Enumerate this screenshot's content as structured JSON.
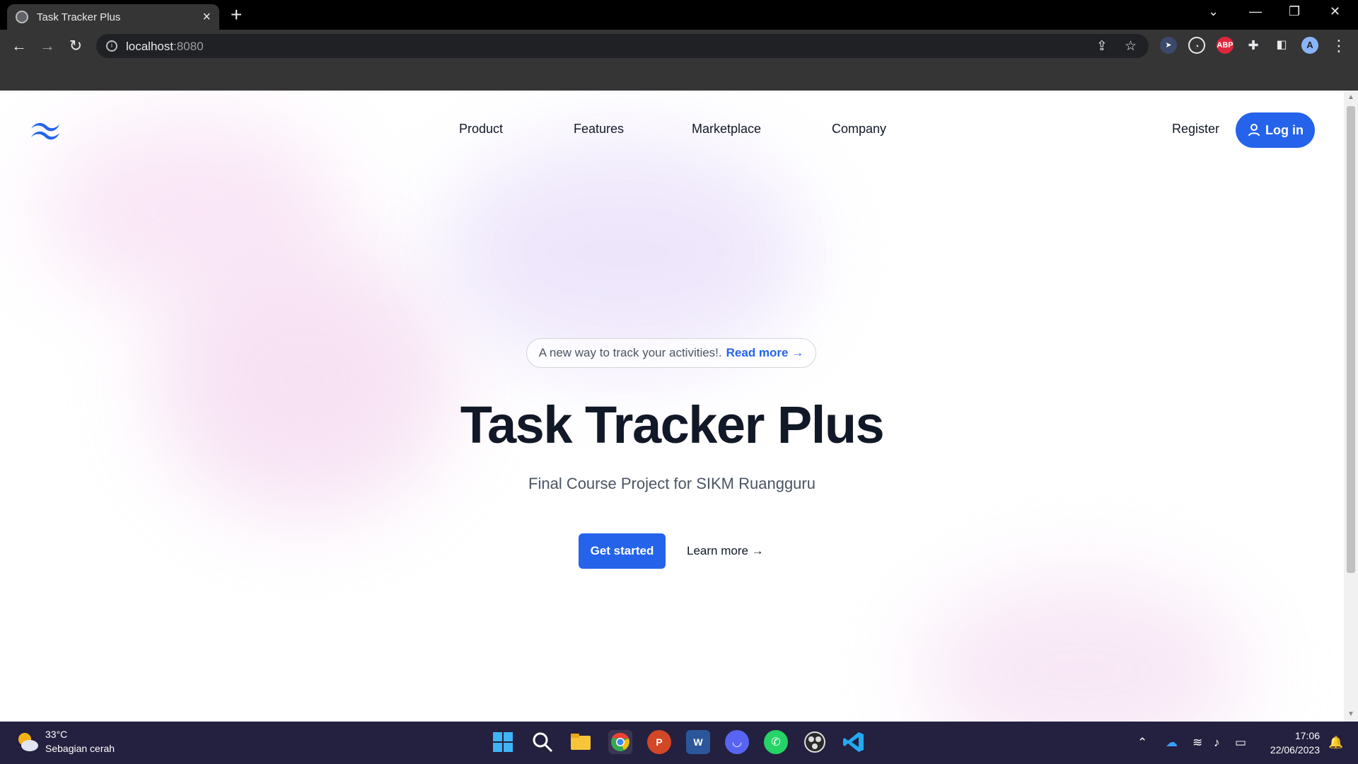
{
  "browser": {
    "tab_title": "Task Tracker Plus",
    "url_host": "localhost",
    "url_port": ":8080",
    "profile_initial": "A"
  },
  "page": {
    "nav": {
      "items": [
        "Product",
        "Features",
        "Marketplace",
        "Company"
      ],
      "register_label": "Register",
      "login_label": "Log in"
    },
    "hero": {
      "announcement": "A new way to track your activities!.",
      "read_more": "Read more →",
      "title": "Task Tracker Plus",
      "subtitle": "Final Course Project for SIKM Ruangguru",
      "cta_primary": "Get started",
      "cta_secondary": "Learn more →"
    }
  },
  "taskbar": {
    "weather_temp": "33°C",
    "weather_condition": "Sebagian cerah",
    "time": "17:06",
    "date": "22/06/2023"
  },
  "colors": {
    "accent": "#2563eb",
    "heading": "#111827",
    "taskbar": "#24203f"
  }
}
